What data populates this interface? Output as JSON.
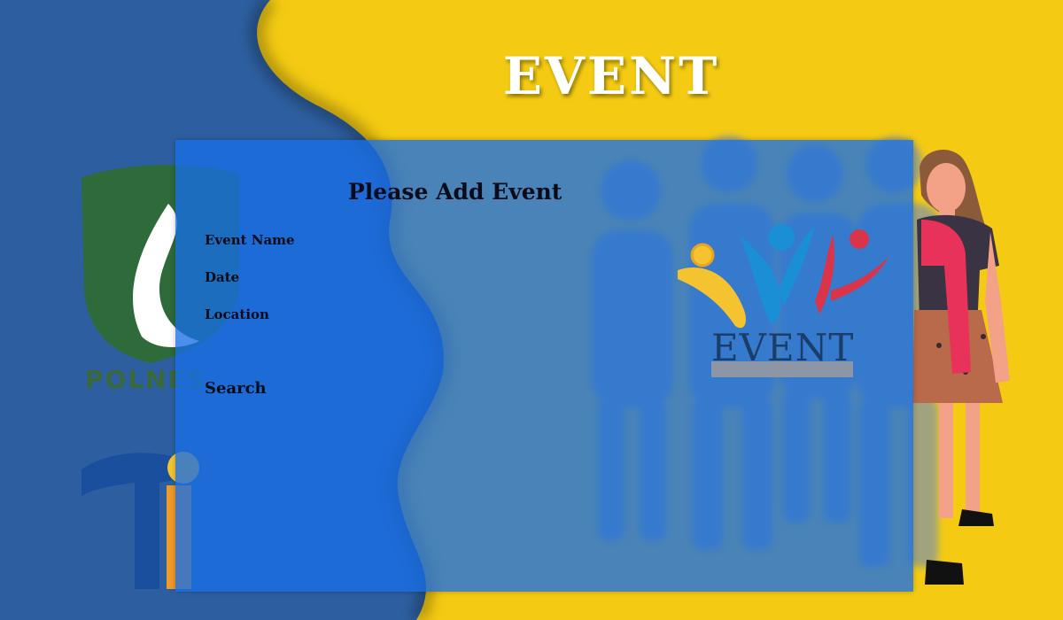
{
  "page": {
    "title": "EVENT"
  },
  "logos": {
    "polnes_text": "POLNES",
    "event_logo_text": "EVENT"
  },
  "form": {
    "heading": "Please Add Event",
    "fields": [
      {
        "label": "Event Name"
      },
      {
        "label": "Date"
      },
      {
        "label": "Location"
      }
    ],
    "search_label": "Search"
  },
  "colors": {
    "background_blue": "#2d5fa0",
    "background_yellow": "#f6c911",
    "panel_blue": "#186ee6",
    "polnes_green": "#3d6a2a",
    "event_logo_yellow": "#f5c330",
    "event_logo_blue": "#1a8fd6",
    "event_logo_red": "#d9344a"
  },
  "icons": {
    "polnes_logo": "shield-flame-icon",
    "side_logo": "t-letter-logo-icon",
    "event_logo": "three-people-icon"
  }
}
